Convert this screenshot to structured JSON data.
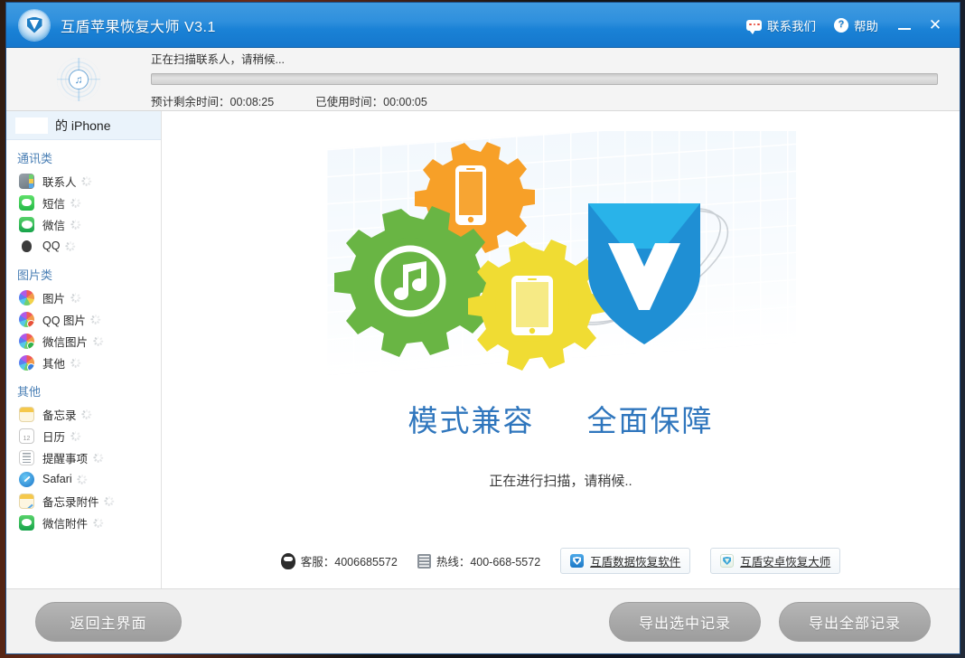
{
  "window": {
    "app_title": "互盾苹果恢复大师 V3.1",
    "logo_icon": "shield-logo-icon",
    "titlebar_links": [
      {
        "label": "联系我们",
        "icon": "chat-bubble-icon",
        "name": "contact-us"
      },
      {
        "label": "帮助",
        "icon": "question-mark-icon",
        "name": "help"
      }
    ],
    "minimize_label": "—",
    "close_label": "✕",
    "accent_color": "#1a82d6"
  },
  "scan_header": {
    "radar_icon": "music-radar-scan-icon",
    "status_text": "正在扫描联系人，请稍候...",
    "progress_percent": 0,
    "remaining_label": "预计剩余时间：00:08:25",
    "elapsed_label": "已使用时间：00:00:05"
  },
  "sidebar": {
    "device": {
      "name": "的 iPhone",
      "icon": "device-icon"
    },
    "groups": [
      {
        "title": "通讯类",
        "items": [
          {
            "label": "联系人",
            "icon": "contacts-icon",
            "icon_class": "ic-contacts",
            "loading": true
          },
          {
            "label": "短信",
            "icon": "sms-icon",
            "icon_class": "ic-sms",
            "loading": true
          },
          {
            "label": "微信",
            "icon": "wechat-icon",
            "icon_class": "ic-wechat",
            "loading": true
          },
          {
            "label": "QQ",
            "icon": "qq-icon",
            "icon_class": "ic-qq",
            "loading": true
          }
        ]
      },
      {
        "title": "图片类",
        "items": [
          {
            "label": "图片",
            "icon": "photos-icon",
            "icon_class": "ic-photo",
            "badge": "",
            "loading": true
          },
          {
            "label": "QQ 图片",
            "icon": "qq-photos-icon",
            "icon_class": "ic-photo",
            "badge": "badge-qq",
            "loading": true
          },
          {
            "label": "微信图片",
            "icon": "wechat-photos-icon",
            "icon_class": "ic-photo",
            "badge": "badge-wx",
            "loading": true
          },
          {
            "label": "其他",
            "icon": "other-photos-icon",
            "icon_class": "ic-photo",
            "badge": "badge-ot",
            "loading": true
          }
        ]
      },
      {
        "title": "其他",
        "items": [
          {
            "label": "备忘录",
            "icon": "notes-icon",
            "icon_class": "ic-notes",
            "loading": true
          },
          {
            "label": "日历",
            "icon": "calendar-icon",
            "icon_class": "ic-cal",
            "loading": true
          },
          {
            "label": "提醒事项",
            "icon": "reminders-icon",
            "icon_class": "ic-remind",
            "loading": true
          },
          {
            "label": "Safari",
            "icon": "safari-icon",
            "icon_class": "ic-safari",
            "loading": true
          },
          {
            "label": "备忘录附件",
            "icon": "note-attachment-icon",
            "icon_class": "ic-noteatt",
            "loading": true
          },
          {
            "label": "微信附件",
            "icon": "wechat-attachment-icon",
            "icon_class": "ic-wxatt",
            "loading": true
          }
        ]
      }
    ]
  },
  "main": {
    "hero_icon": "gears-phone-shield-illustration",
    "taglines": [
      "模式兼容",
      "全面保障"
    ],
    "scan_caption": "正在进行扫描，请稍候..",
    "tagline_color": "#2f76bd",
    "contact": {
      "service_icon": "qq-penguin-icon",
      "service_label": "客服：4006685572",
      "hotline_icon": "hotline-icon",
      "hotline_label": "热线：400-668-5572",
      "buttons": [
        {
          "label": "互盾数据恢复软件",
          "icon": "blue-shield-icon"
        },
        {
          "label": "互盾安卓恢复大师",
          "icon": "green-shield-icon"
        }
      ]
    }
  },
  "footer": {
    "home_label": "返回主界面",
    "export_selected_label": "导出选中记录",
    "export_all_label": "导出全部记录"
  }
}
